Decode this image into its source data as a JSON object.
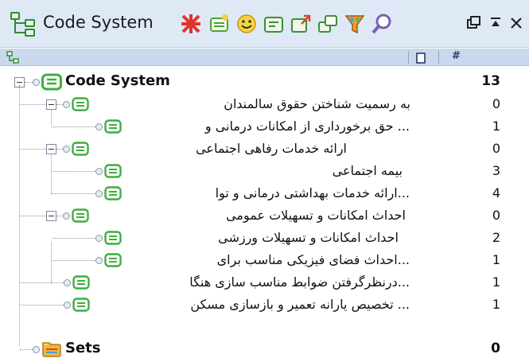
{
  "window": {
    "title": "Code System",
    "title_icon": "code-system-tree-icon",
    "toolbar_icons": [
      "activate-all-codes-icon",
      "new-code-icon",
      "emoticode-icon",
      "code-favorites-icon",
      "code-matrix-icon",
      "code-relations-icon",
      "color-filter-icon",
      "search-code-icon"
    ],
    "window_buttons": [
      "undock-window-icon",
      "pin-window-icon",
      "close-window-icon"
    ]
  },
  "header": {
    "left_icon": "code-tree-header-icon",
    "column_icon": "memo-column-icon",
    "count_label": "#"
  },
  "tree": {
    "root": {
      "label": "Code System",
      "count": "13"
    },
    "items": [
      {
        "label": "به رسمیت شناختن حقوق سالمندان",
        "count": "0"
      },
      {
        "label": "... حق برخورداری از امکانات درمانی و",
        "count": "1"
      },
      {
        "label": "ارائه خدمات رفاهی اجتماعی",
        "count": "0"
      },
      {
        "label": "بیمه اجتماعی",
        "count": "3"
      },
      {
        "label": "...ارائه خدمات بهداشتی درمانی و توا",
        "count": "4"
      },
      {
        "label": "احداث امکانات و تسهیلات عمومی",
        "count": "0"
      },
      {
        "label": "احداث امکانات و تسهیلات ورزشی",
        "count": "2"
      },
      {
        "label": "...احداث فضای فیزیکی مناسب برای",
        "count": "1"
      },
      {
        "label": "...درنظرگرفتن ضوابط مناسب سازی هنگا",
        "count": "1"
      },
      {
        "label": "... تخصیص یارانه تعمیر و بازسازی مسکن",
        "count": "1"
      }
    ],
    "sets": {
      "label": "Sets",
      "count": "0",
      "icon": "sets-folder-icon"
    }
  },
  "colors": {
    "titlebar_bg": "#dfe9f6",
    "header_bg": "#c9d8ec",
    "code_icon_green": "#3cae3f"
  }
}
